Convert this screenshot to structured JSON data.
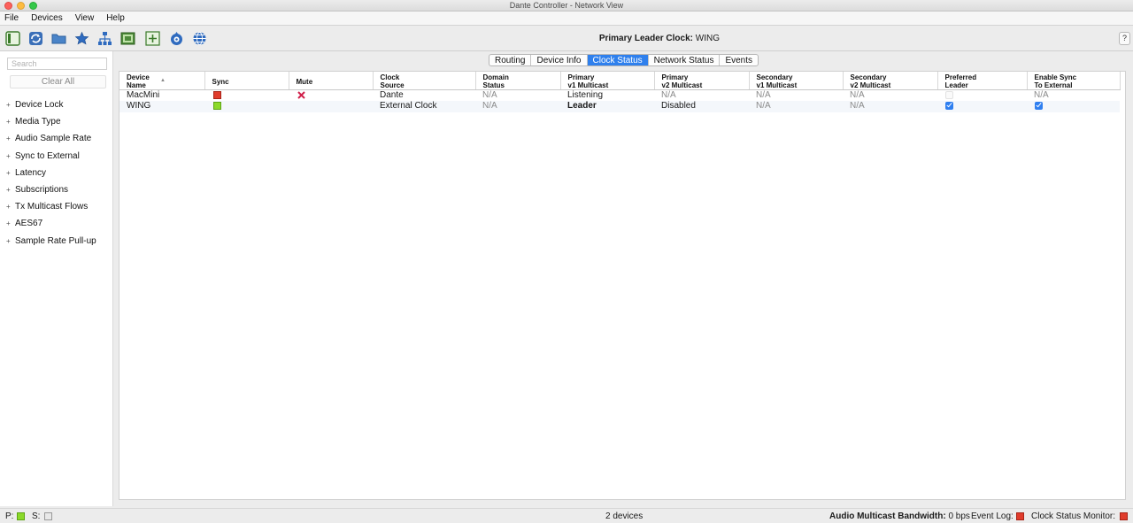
{
  "window": {
    "title": "Dante Controller - Network View"
  },
  "menu": [
    "File",
    "Devices",
    "View",
    "Help"
  ],
  "toolbar": {
    "buttons": [
      "panel-toggle-icon",
      "refresh-icon",
      "folder-icon",
      "star-icon",
      "network-tree-icon",
      "device-view-icon",
      "add-icon",
      "clock-icon",
      "globe-icon"
    ],
    "primary_leader_label": "Primary Leader Clock:",
    "primary_leader_value": "WING",
    "help": "?"
  },
  "sidebar": {
    "search_placeholder": "Search",
    "clear_all": "Clear All",
    "filters": [
      "Device Lock",
      "Media Type",
      "Audio Sample Rate",
      "Sync to External",
      "Latency",
      "Subscriptions",
      "Tx Multicast Flows",
      "AES67",
      "Sample Rate Pull-up"
    ]
  },
  "tabs": [
    {
      "label": "Routing",
      "active": false
    },
    {
      "label": "Device Info",
      "active": false
    },
    {
      "label": "Clock Status",
      "active": true
    },
    {
      "label": "Network Status",
      "active": false
    },
    {
      "label": "Events",
      "active": false
    }
  ],
  "table": {
    "columns": [
      [
        "Device",
        "Name"
      ],
      [
        "Sync",
        ""
      ],
      [
        "Mute",
        ""
      ],
      [
        "Clock",
        "Source"
      ],
      [
        "Domain",
        "Status"
      ],
      [
        "Primary",
        "v1 Multicast"
      ],
      [
        "Primary",
        "v2 Multicast"
      ],
      [
        "Secondary",
        "v1 Multicast"
      ],
      [
        "Secondary",
        "v2 Multicast"
      ],
      [
        "Preferred",
        "Leader"
      ],
      [
        "Enable Sync",
        "To External"
      ]
    ],
    "rows": [
      {
        "name": "MacMini",
        "sync": "red",
        "mute": "muted",
        "clock_source": "Dante",
        "domain_status": "N/A",
        "primary_v1": "Listening",
        "primary_v2": "N/A",
        "secondary_v1": "N/A",
        "secondary_v2": "N/A",
        "preferred_leader": "disabled",
        "enable_sync_text": "N/A"
      },
      {
        "name": "WING",
        "sync": "green",
        "mute": "none",
        "clock_source": "External Clock",
        "domain_status": "N/A",
        "primary_v1": "Leader",
        "primary_v2": "Disabled",
        "secondary_v1": "N/A",
        "secondary_v2": "N/A",
        "preferred_leader": "checked",
        "enable_sync_text": "checked"
      }
    ]
  },
  "status": {
    "p_label": "P:",
    "s_label": "S:",
    "device_count": "2 devices",
    "bandwidth_label": "Audio Multicast Bandwidth:",
    "bandwidth_value": "0 bps",
    "event_log": "Event Log:",
    "clock_monitor": "Clock Status Monitor:"
  },
  "colors": {
    "accent": "#2f80ed",
    "sync_red": "#e03c2c",
    "sync_green": "#8bd92a"
  }
}
